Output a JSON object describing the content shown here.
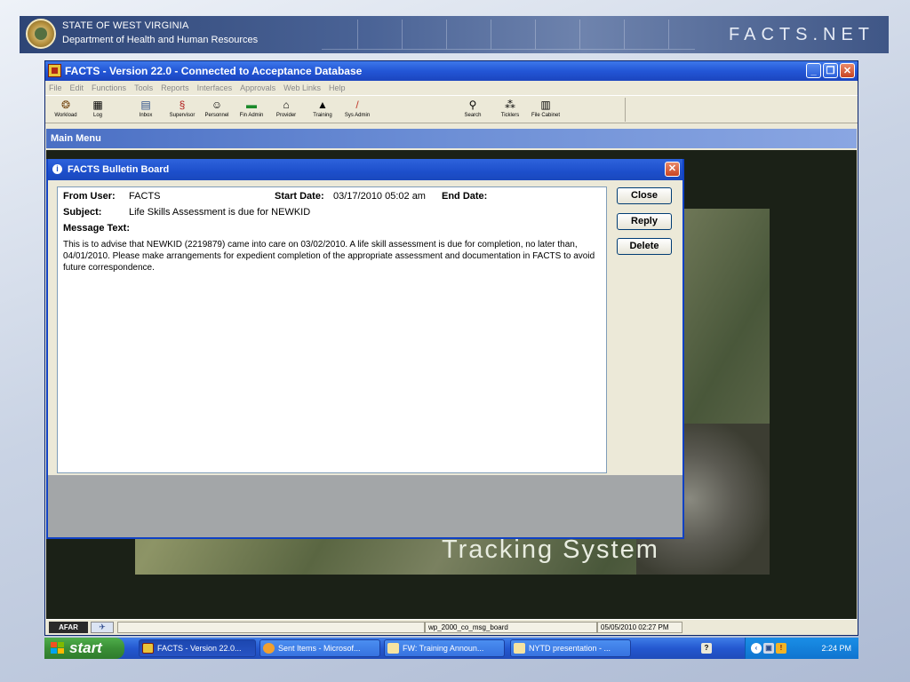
{
  "banner": {
    "state": "STATE OF WEST VIRGINIA",
    "department": "Department of Health and Human Resources",
    "logo": "FACTS.NET"
  },
  "app": {
    "title": "FACTS - Version 22.0 - Connected to Acceptance Database",
    "menu": [
      "File",
      "Edit",
      "Functions",
      "Tools",
      "Reports",
      "Interfaces",
      "Approvals",
      "Web Links",
      "Help"
    ],
    "toolbar": [
      {
        "label": "Workload",
        "icon": "workload-icon"
      },
      {
        "label": "Log",
        "icon": "log-icon"
      },
      {
        "label": "Inbox",
        "icon": "inbox-icon"
      },
      {
        "label": "Supervisor",
        "icon": "supervisor-icon"
      },
      {
        "label": "Personnel",
        "icon": "personnel-icon"
      },
      {
        "label": "Fin Admin",
        "icon": "fin-admin-icon"
      },
      {
        "label": "Provider",
        "icon": "provider-icon"
      },
      {
        "label": "Training",
        "icon": "training-icon"
      },
      {
        "label": "Sys Admin",
        "icon": "sys-admin-icon"
      },
      {
        "label": "Search",
        "icon": "search-icon"
      },
      {
        "label": "Ticklers",
        "icon": "ticklers-icon"
      },
      {
        "label": "File Cabinet",
        "icon": "file-cabinet-icon"
      }
    ],
    "main_menu_label": "Main Menu",
    "background_caption": "Tracking System",
    "status": {
      "logo": "AFAR",
      "form": "wp_2000_co_msg_board",
      "datetime": "05/05/2010 02:27 PM"
    }
  },
  "dialog": {
    "title": "FACTS Bulletin Board",
    "from_label": "From User:",
    "from_value": "FACTS",
    "start_label": "Start Date:",
    "start_value": "03/17/2010 05:02 am",
    "end_label": "End Date:",
    "end_value": "",
    "subject_label": "Subject:",
    "subject_value": "Life Skills Assessment is due for NEWKID",
    "message_label": "Message Text:",
    "message_body": "This is to advise that NEWKID (2219879) came into care on 03/02/2010. A life skill assessment is due for completion, no later than, 04/01/2010. Please make arrangements for expedient completion of the appropriate assessment and documentation in FACTS to avoid future correspondence.",
    "buttons": {
      "close": "Close",
      "reply": "Reply",
      "delete": "Delete"
    }
  },
  "taskbar": {
    "start": "start",
    "tasks": [
      {
        "label": "FACTS - Version 22.0...",
        "active": true
      },
      {
        "label": "Sent Items - Microsof...",
        "active": false
      },
      {
        "label": "FW: Training Announ...",
        "active": false
      },
      {
        "label": "NYTD presentation - ...",
        "active": false
      }
    ],
    "clock": "2:24 PM"
  },
  "colors": {
    "title_blue": "#2356d6",
    "start_green": "#3a8f36",
    "close_red": "#c94422",
    "background_dark": "#1b2117"
  }
}
